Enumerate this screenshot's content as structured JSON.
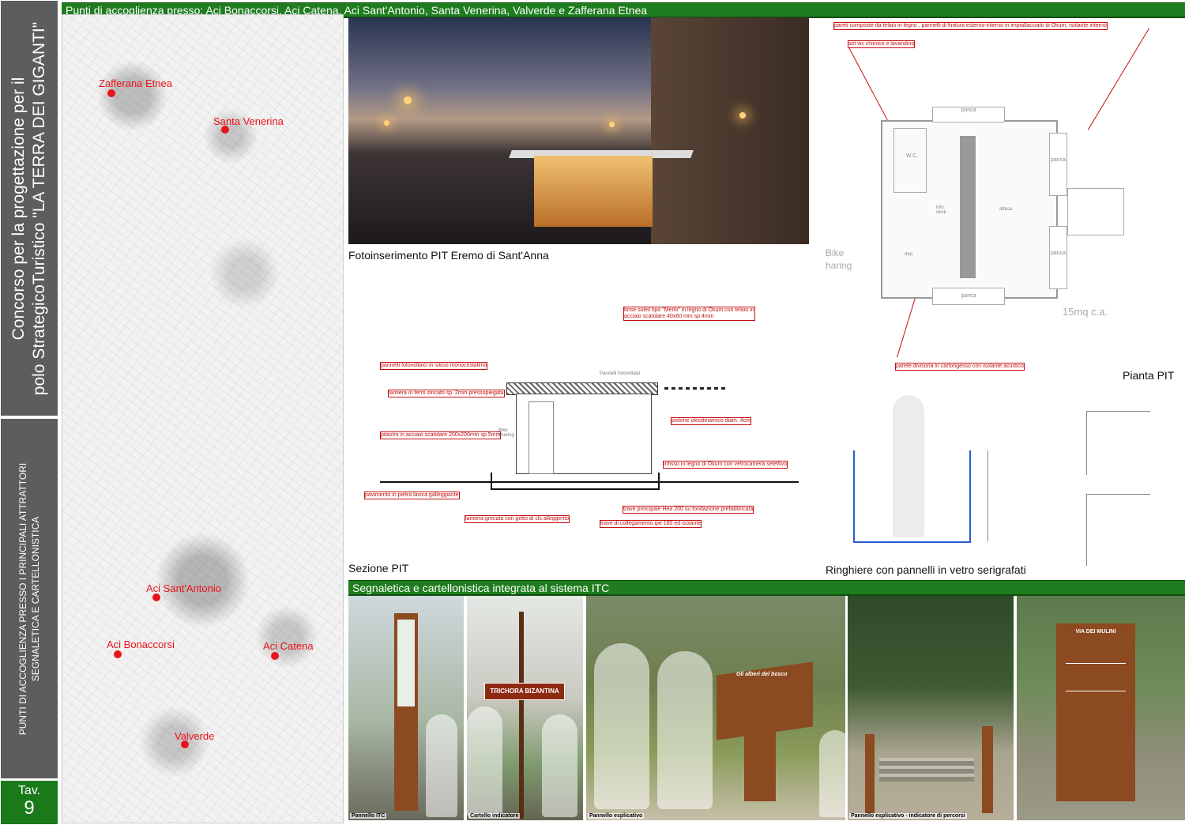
{
  "sidebar": {
    "title_line1": "Concorso per la progettazione per il",
    "title_line2": "polo StrategicoTuristico \"LA TERRA DEI GIGANTI\"",
    "subtitle_line1": "PUNTI DI ACCOGLIENZA PRESSO I PRINCIPALI ATTRATTORI",
    "subtitle_line2": "SEGNALETICA E CARTELLONISTICA",
    "tav_label": "Tav.",
    "tav_number": "9"
  },
  "header_top": "Punti di accoglienza presso: Aci Bonaccorsi, Aci Catena, Aci Sant'Antonio, Santa Venerina, Valverde e Zafferana Etnea",
  "header_bottom": "Segnaletica e cartellonistica integrata al sistema ITC",
  "map_labels": {
    "zafferana": "Zafferana Etnea",
    "santa_venerina": "Santa Venerina",
    "aci_santantonio": "Aci Sant'Antonio",
    "aci_bonaccorsi": "Aci Bonaccorsi",
    "aci_catena": "Aci Catena",
    "valverde": "Valverde"
  },
  "captions": {
    "photo": "Fotoinserimento PIT Eremo di Sant'Anna",
    "section": "Sezione PIT",
    "plan": "Pianta PIT",
    "railings": "Ringhiere con pannelli in vetro serigrafati"
  },
  "plan_notes": {
    "n1": "pareti composte da telaio in legno , pannelli di finitura esterno-interno in impiallacciato di Okum, isolante interno",
    "n2": "set wc chimico e lavandino",
    "n3": "parete divisoria in cartongesso con isolante acustico",
    "bike": "Bike\nharing",
    "area": "15mq c.a.",
    "panca_top": "panca",
    "panca_bottom": "panca",
    "panca_right1": "panca",
    "panca_right2": "panca",
    "wc": "W.C.",
    "info": "info\ndesk",
    "attesa": "attesa",
    "dep": "dep."
  },
  "section_notes": {
    "s1": "brise soleil tipo \"Merlo\" in legno di Okum con telaio in\nacciaio scatolare 40x60 mm sp 4mm",
    "s2": "pannelli fotovoltaici in silicio monocristallino",
    "s3": "lamiera in ferro zincato sp. 2mm pressopiegata",
    "s4": "pilastro in acciaio scatolare 200x200mm sp.5mm",
    "s5": "pistone oleodinamico diam. 4cm",
    "s6": "infisso in legno di Okum con vetrocamera selettivo",
    "s7": "pavimento in pietra lavica galleggiante",
    "s8": "lamiera grecata con getto di cls alleggerito",
    "s9": "trave principale Hea 200 su fondazione prefabbricata",
    "s10": "trave di collegamento ipe 160 ed isolante",
    "pv": "Pannelli fotovoltaici",
    "bike": "Bike\nsharing"
  },
  "bottom_captions": {
    "p1": "Pannello ITC",
    "p2": "Cartello indicatore",
    "p3": "Pannello esplicativo",
    "p4": "Pannello esplicativo - indicatore di percorsi"
  },
  "sign_texts": {
    "trichora": "TRICHORA BIZANTINA",
    "alberi": "Gli alberi del bosco",
    "mulini": "VIA DEI MULINI"
  }
}
